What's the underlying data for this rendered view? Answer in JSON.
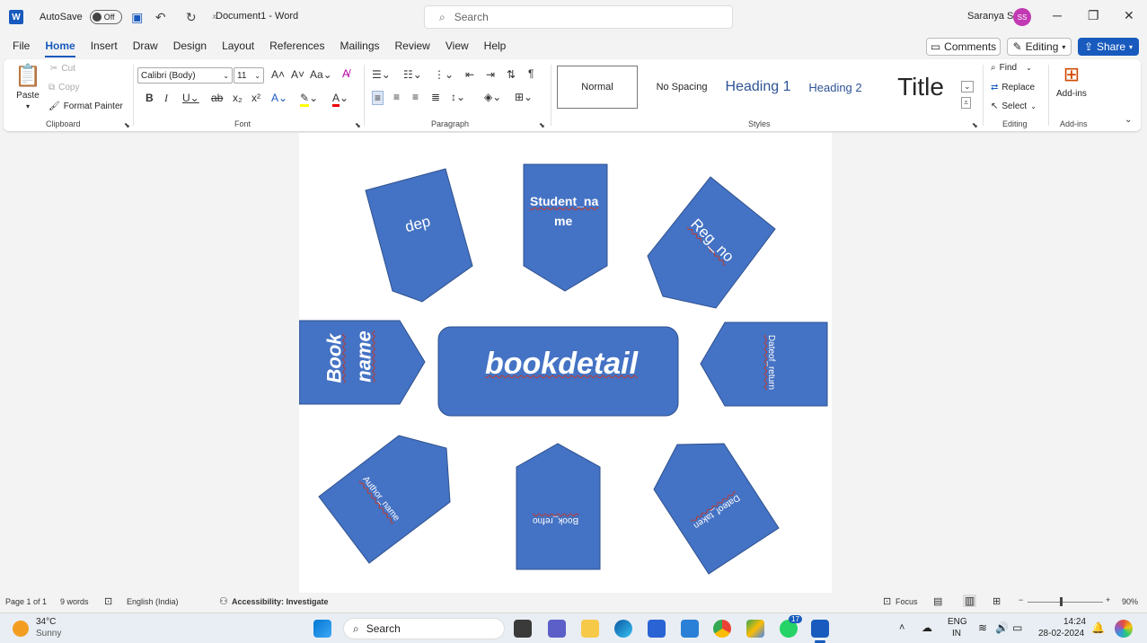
{
  "titlebar": {
    "autosave_label": "AutoSave",
    "toggle_state": "Off",
    "document_title": "Document1 - Word",
    "search_placeholder": "Search",
    "user_name": "Saranya S",
    "user_initials": "SS"
  },
  "menu": {
    "tabs": [
      "File",
      "Home",
      "Insert",
      "Draw",
      "Design",
      "Layout",
      "References",
      "Mailings",
      "Review",
      "View",
      "Help"
    ],
    "active": "Home",
    "comments_label": "Comments",
    "editing_label": "Editing",
    "share_label": "Share"
  },
  "ribbon": {
    "clipboard": {
      "paste": "Paste",
      "cut": "Cut",
      "copy": "Copy",
      "format_painter": "Format Painter",
      "group": "Clipboard"
    },
    "font": {
      "family": "Calibri (Body)",
      "size": "11",
      "group": "Font"
    },
    "paragraph": {
      "group": "Paragraph"
    },
    "styles": {
      "normal": "Normal",
      "no_spacing": "No Spacing",
      "heading1": "Heading 1",
      "heading2": "Heading 2",
      "title": "Title",
      "group": "Styles"
    },
    "editing": {
      "find": "Find",
      "replace": "Replace",
      "select": "Select",
      "group": "Editing"
    },
    "addins": {
      "label": "Add-ins",
      "group": "Add-ins"
    }
  },
  "document": {
    "center": "bookdetail",
    "shapes": {
      "dep": "dep",
      "student_name_1": "Student_na",
      "student_name_2": "me",
      "reg_no": "Reg_no",
      "book_name_1": "Book",
      "book_name_2": "name",
      "dateof_return": "Dateof_return",
      "author_name": "Author_name",
      "book_refno": "Book_refno",
      "dateof_taken": "Dateof_taken"
    }
  },
  "statusbar": {
    "page": "Page 1 of 1",
    "words": "9 words",
    "language": "English (India)",
    "accessibility": "Accessibility: Investigate",
    "focus": "Focus",
    "zoom": "90%"
  },
  "taskbar": {
    "temp": "34°C",
    "weather": "Sunny",
    "search": "Search",
    "lang1": "ENG",
    "lang2": "IN",
    "time": "14:24",
    "date": "28-02-2024",
    "badge": "17"
  },
  "colors": {
    "accent": "#185abd",
    "shape_fill": "#4472c4",
    "shape_stroke": "#2f528f"
  }
}
